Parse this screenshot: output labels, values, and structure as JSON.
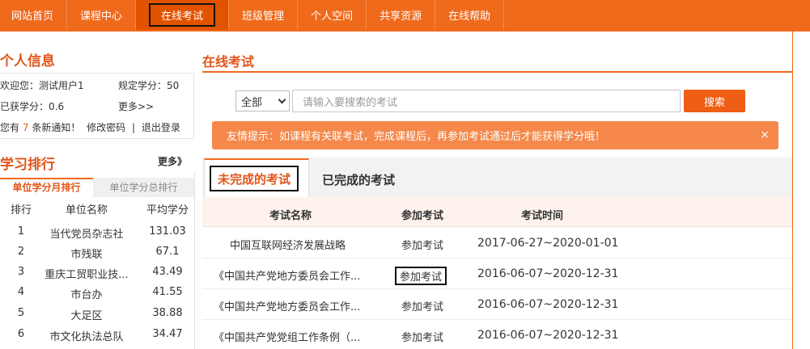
{
  "nav": {
    "items": [
      "网站首页",
      "课程中心",
      "在线考试",
      "班级管理",
      "个人空间",
      "共享资源",
      "在线帮助"
    ],
    "active": "在线考试"
  },
  "personal": {
    "title": "个人信息",
    "welcome": "欢迎您：测试用户1",
    "required_credits": "规定学分：50",
    "earned_credits": "已获学分：0.6",
    "more": "更多>>",
    "notice_prefix": "您有",
    "notice_count": "7",
    "notice_suffix": "条新通知！",
    "change_password": "修改密码",
    "separator": "|",
    "logout": "退出登录"
  },
  "ranking": {
    "title": "学习排行",
    "more": "更多》",
    "tabs": [
      "单位学分月排行",
      "单位学分总排行"
    ],
    "headers": [
      "排行",
      "单位名称",
      "平均学分"
    ],
    "rows": [
      [
        "1",
        "当代党员杂志社",
        "131.03"
      ],
      [
        "2",
        "市残联",
        "67.1"
      ],
      [
        "3",
        "重庆工贸职业技...",
        "43.49"
      ],
      [
        "4",
        "市台办",
        "41.55"
      ],
      [
        "5",
        "大足区",
        "38.88"
      ],
      [
        "6",
        "市文化执法总队",
        "34.47"
      ]
    ]
  },
  "main": {
    "title": "在线考试",
    "search": {
      "select_value": "全部",
      "placeholder": "请输入要搜索的考试",
      "button": "搜索"
    },
    "tip": "友情提示：如课程有关联考试，完成课程后，再参加考试通过后才能获得学分哦！",
    "tip_close": "×",
    "tabs": [
      "未完成的考试",
      "已完成的考试"
    ],
    "table": {
      "headers": [
        "考试名称",
        "参加考试",
        "考试时间"
      ],
      "rows": [
        {
          "name": "中国互联网经济发展战略",
          "action": "参加考试",
          "time": "2017-06-27~2020-01-01"
        },
        {
          "name": "《中国共产党地方委员会工作...",
          "action": "参加考试",
          "time": "2016-06-07~2020-12-31"
        },
        {
          "name": "《中国共产党地方委员会工作...",
          "action": "参加考试",
          "time": "2016-06-07~2020-12-31"
        },
        {
          "name": "《中国共产党党组工作条例（...",
          "action": "参加考试",
          "time": "2016-06-07~2020-12-31"
        }
      ]
    }
  },
  "colors": {
    "brand": "#f06a1c",
    "accent_text": "#e0561a",
    "tip_bg": "#f5884a"
  }
}
